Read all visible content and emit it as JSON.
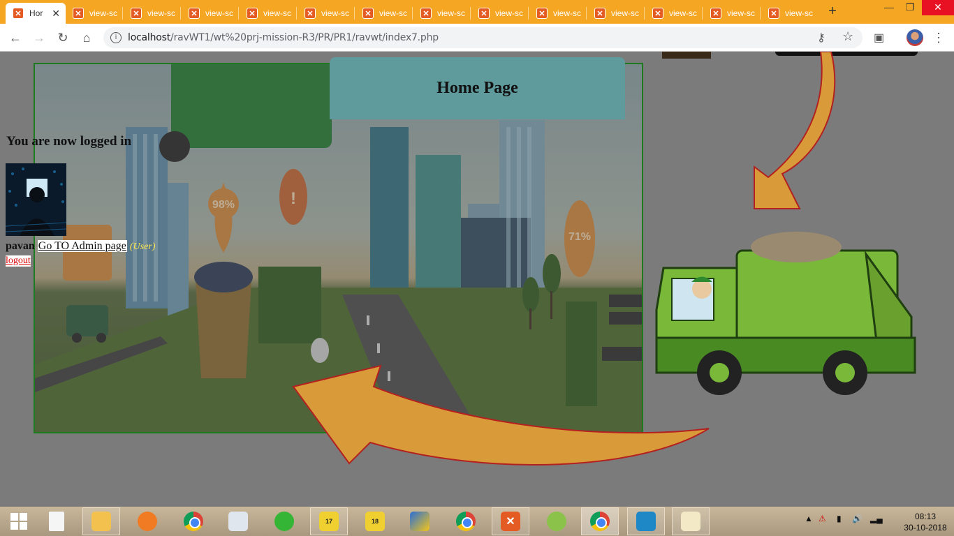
{
  "browser": {
    "active_tab_title": "Hor",
    "tabs": [
      "view-sc",
      "view-sc",
      "view-sc",
      "view-sc",
      "view-sc",
      "view-sc",
      "view-sc",
      "view-sc",
      "view-sc",
      "view-sc",
      "view-sc",
      "view-sc",
      "view-sc"
    ],
    "new_tab_label": "+",
    "url_host": "localhost",
    "url_path": "/ravWT1/wt%20prj-mission-R3/PR/PR1/ravwt/index7.php"
  },
  "page": {
    "header_title": "Home Page",
    "logged_in_message": "You are now logged in",
    "username": "pavan",
    "admin_link": "Go TO Admin page",
    "role": "(User)",
    "logout_link": "logout",
    "scene_labels": {
      "pin1": "98%",
      "pin2": "!",
      "pin3": "71%"
    }
  },
  "taskbar": {
    "clock_time": "08:13",
    "clock_date": "30-10-2018",
    "badge_17": "17",
    "badge_18": "18"
  },
  "colors": {
    "tabstrip": "#f5a623",
    "header_box": "#5f9a9c",
    "scene_border": "#1e7a1e",
    "logout_link": "#dd0000",
    "role_text": "#ffe94d"
  }
}
